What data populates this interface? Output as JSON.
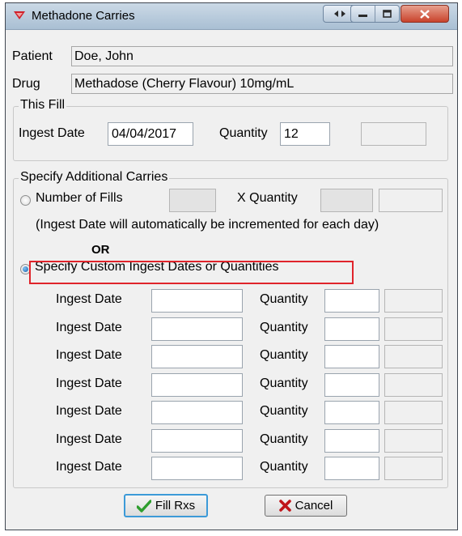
{
  "window": {
    "title": "Methadone Carries"
  },
  "patient": {
    "label": "Patient",
    "value": "Doe, John"
  },
  "drug": {
    "label": "Drug",
    "value": "Methadose (Cherry Flavour) 10mg/mL"
  },
  "this_fill": {
    "title": "This Fill",
    "ingest_date_label": "Ingest Date",
    "ingest_date_value": "04/04/2017",
    "quantity_label": "Quantity",
    "quantity_value": "12"
  },
  "additional": {
    "title": "Specify Additional Carries",
    "number_of_fills_label": "Number of Fills",
    "x_quantity_label": "X  Quantity",
    "note": "(Ingest Date will automatically be incremented for each day)",
    "or_label": "OR",
    "custom_label": "Specify Custom Ingest Dates or Quantities",
    "selected_option": "custom",
    "rows": [
      {
        "date_label": "Ingest Date",
        "date_value": "",
        "qty_label": "Quantity",
        "qty_value": ""
      },
      {
        "date_label": "Ingest Date",
        "date_value": "",
        "qty_label": "Quantity",
        "qty_value": ""
      },
      {
        "date_label": "Ingest Date",
        "date_value": "",
        "qty_label": "Quantity",
        "qty_value": ""
      },
      {
        "date_label": "Ingest Date",
        "date_value": "",
        "qty_label": "Quantity",
        "qty_value": ""
      },
      {
        "date_label": "Ingest Date",
        "date_value": "",
        "qty_label": "Quantity",
        "qty_value": ""
      },
      {
        "date_label": "Ingest Date",
        "date_value": "",
        "qty_label": "Quantity",
        "qty_value": ""
      },
      {
        "date_label": "Ingest Date",
        "date_value": "",
        "qty_label": "Quantity",
        "qty_value": ""
      }
    ]
  },
  "buttons": {
    "fill_label": "Fill Rxs",
    "cancel_label": "Cancel"
  },
  "icons": {
    "app": "methadone-app-icon",
    "fill": "checkmark-icon",
    "cancel": "x-mark-icon"
  },
  "colors": {
    "highlight": "#e0242b",
    "checkmark": "#2e9e2e",
    "cancel_x": "#c0161b",
    "default_button_border": "#3c9ad8"
  }
}
